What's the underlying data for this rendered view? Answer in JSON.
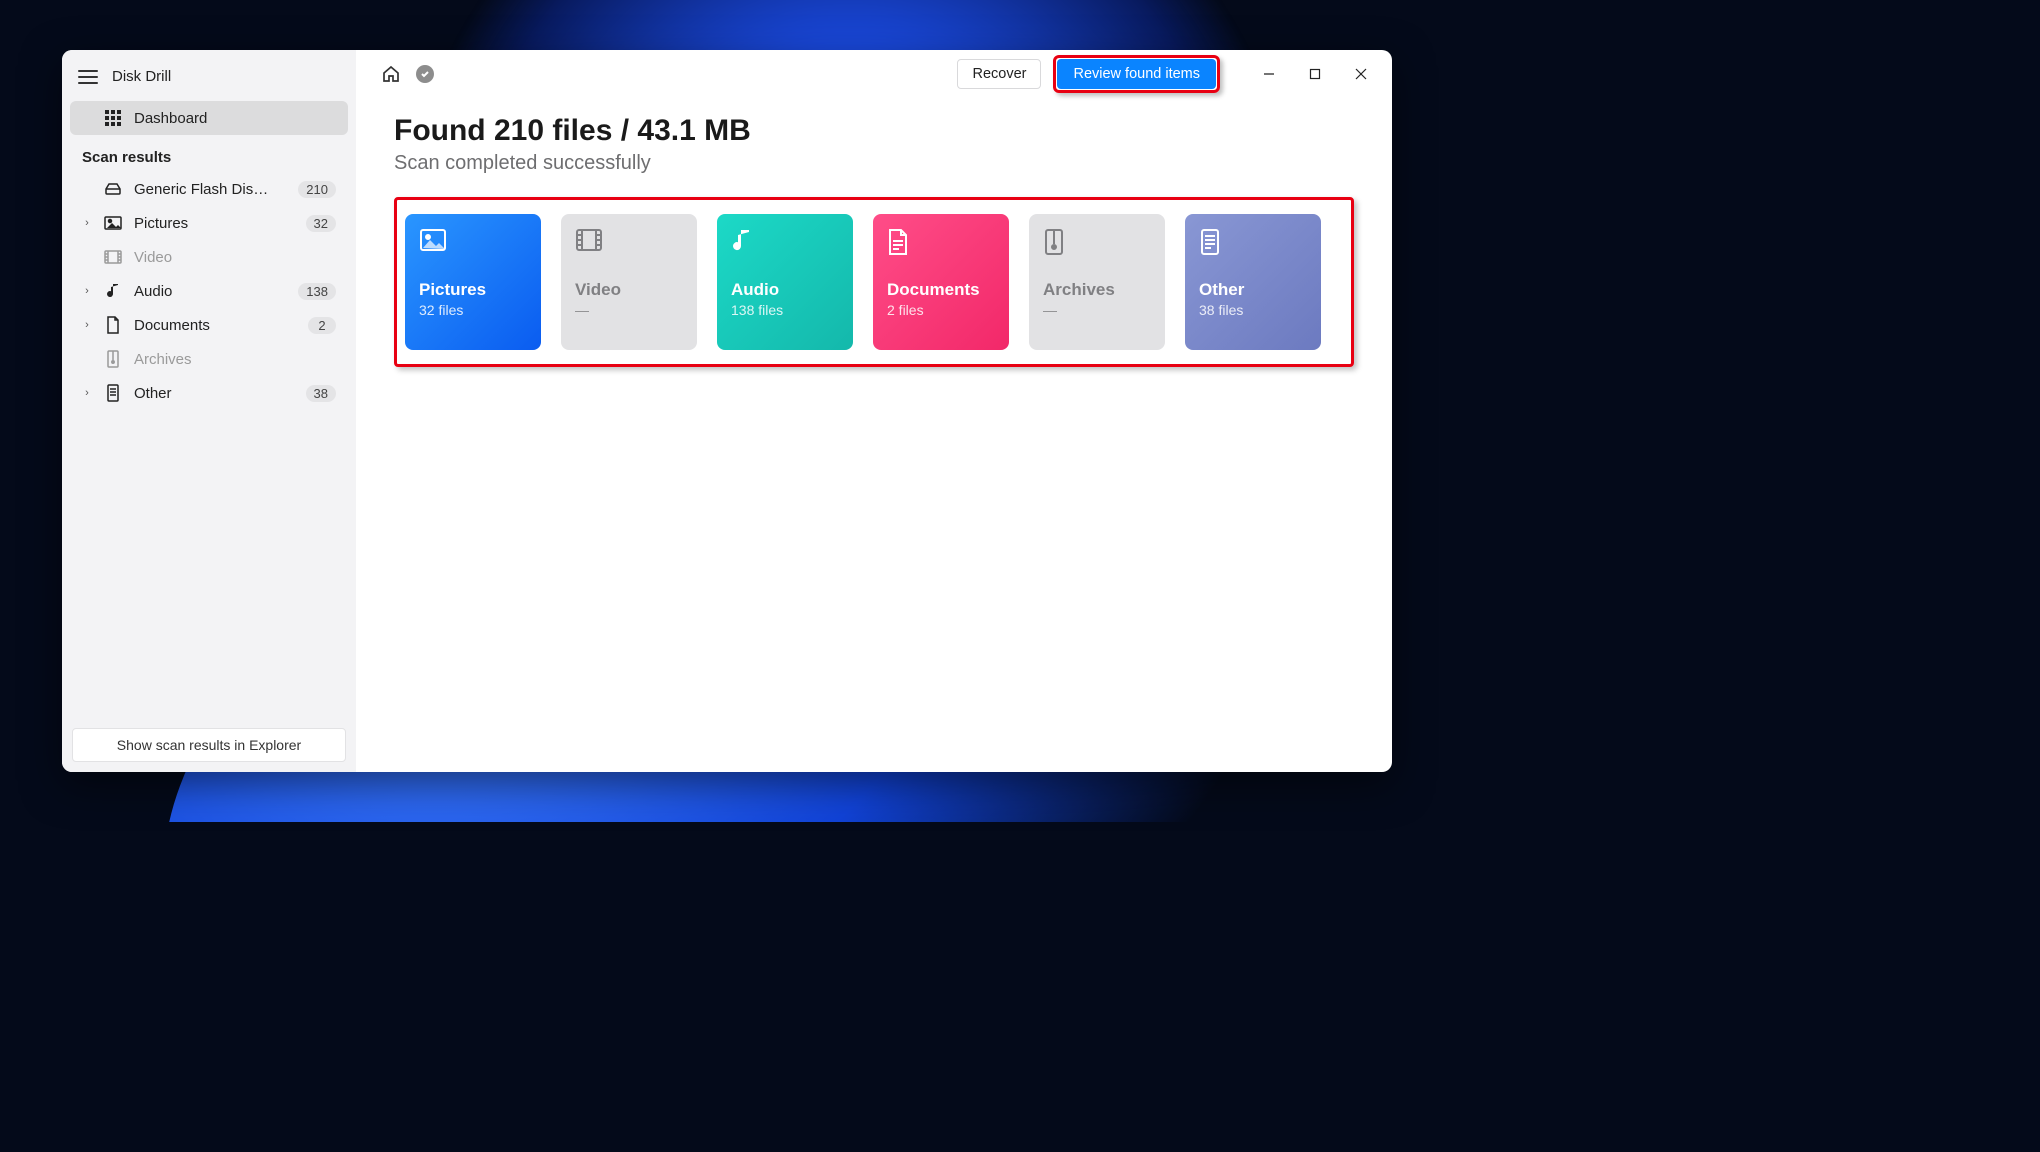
{
  "app": {
    "name": "Disk Drill"
  },
  "sidebar": {
    "dashboard": "Dashboard",
    "scan_results_header": "Scan results",
    "items": [
      {
        "label": "Generic Flash Disk USB…",
        "count": "210"
      },
      {
        "label": "Pictures",
        "count": "32"
      },
      {
        "label": "Video",
        "count": ""
      },
      {
        "label": "Audio",
        "count": "138"
      },
      {
        "label": "Documents",
        "count": "2"
      },
      {
        "label": "Archives",
        "count": ""
      },
      {
        "label": "Other",
        "count": "38"
      }
    ],
    "explorer_button": "Show scan results in Explorer"
  },
  "topbar": {
    "recover": "Recover",
    "review": "Review found items"
  },
  "main": {
    "headline": "Found 210 files / 43.1 MB",
    "subhead": "Scan completed successfully",
    "cards": [
      {
        "title": "Pictures",
        "sub": "32 files"
      },
      {
        "title": "Video",
        "sub": "—"
      },
      {
        "title": "Audio",
        "sub": "138 files"
      },
      {
        "title": "Documents",
        "sub": "2 files"
      },
      {
        "title": "Archives",
        "sub": "—"
      },
      {
        "title": "Other",
        "sub": "38 files"
      }
    ]
  }
}
